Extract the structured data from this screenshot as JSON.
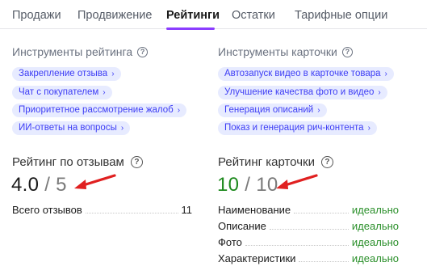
{
  "tabs": [
    {
      "label": "Продажи",
      "active": false
    },
    {
      "label": "Продвижение",
      "active": false
    },
    {
      "label": "Рейтинги",
      "active": true
    },
    {
      "label": "Остатки",
      "active": false
    },
    {
      "label": "Тарифные опции",
      "active": false
    }
  ],
  "accent_color": "#8b3dff",
  "rating_tools": {
    "title": "Инструменты рейтинга",
    "chips": [
      "Закрепление отзыва",
      "Чат с покупателем",
      "Приоритетное рассмотрение жалоб",
      "ИИ-ответы на вопросы"
    ]
  },
  "card_tools": {
    "title": "Инструменты карточки",
    "chips": [
      "Автозапуск видео в карточке товара",
      "Улучшение качества фото и видео",
      "Генерация описаний",
      "Показ и генерация рич-контента"
    ]
  },
  "review_rating": {
    "title": "Рейтинг по отзывам",
    "value": "4.0",
    "separator": "/",
    "max": "5",
    "rows": [
      {
        "label": "Всего отзывов",
        "value": "11"
      }
    ]
  },
  "card_rating": {
    "title": "Рейтинг карточки",
    "value": "10",
    "separator": "/",
    "max": "10",
    "rows": [
      {
        "label": "Наименование",
        "value": "идеально"
      },
      {
        "label": "Описание",
        "value": "идеально"
      },
      {
        "label": "Фото",
        "value": "идеально"
      },
      {
        "label": "Характеристики",
        "value": "идеально"
      }
    ]
  },
  "icons": {
    "help": "question-circle-icon",
    "chip_chevron": "chevron-right-icon",
    "annotation": "red-arrow-icon"
  }
}
